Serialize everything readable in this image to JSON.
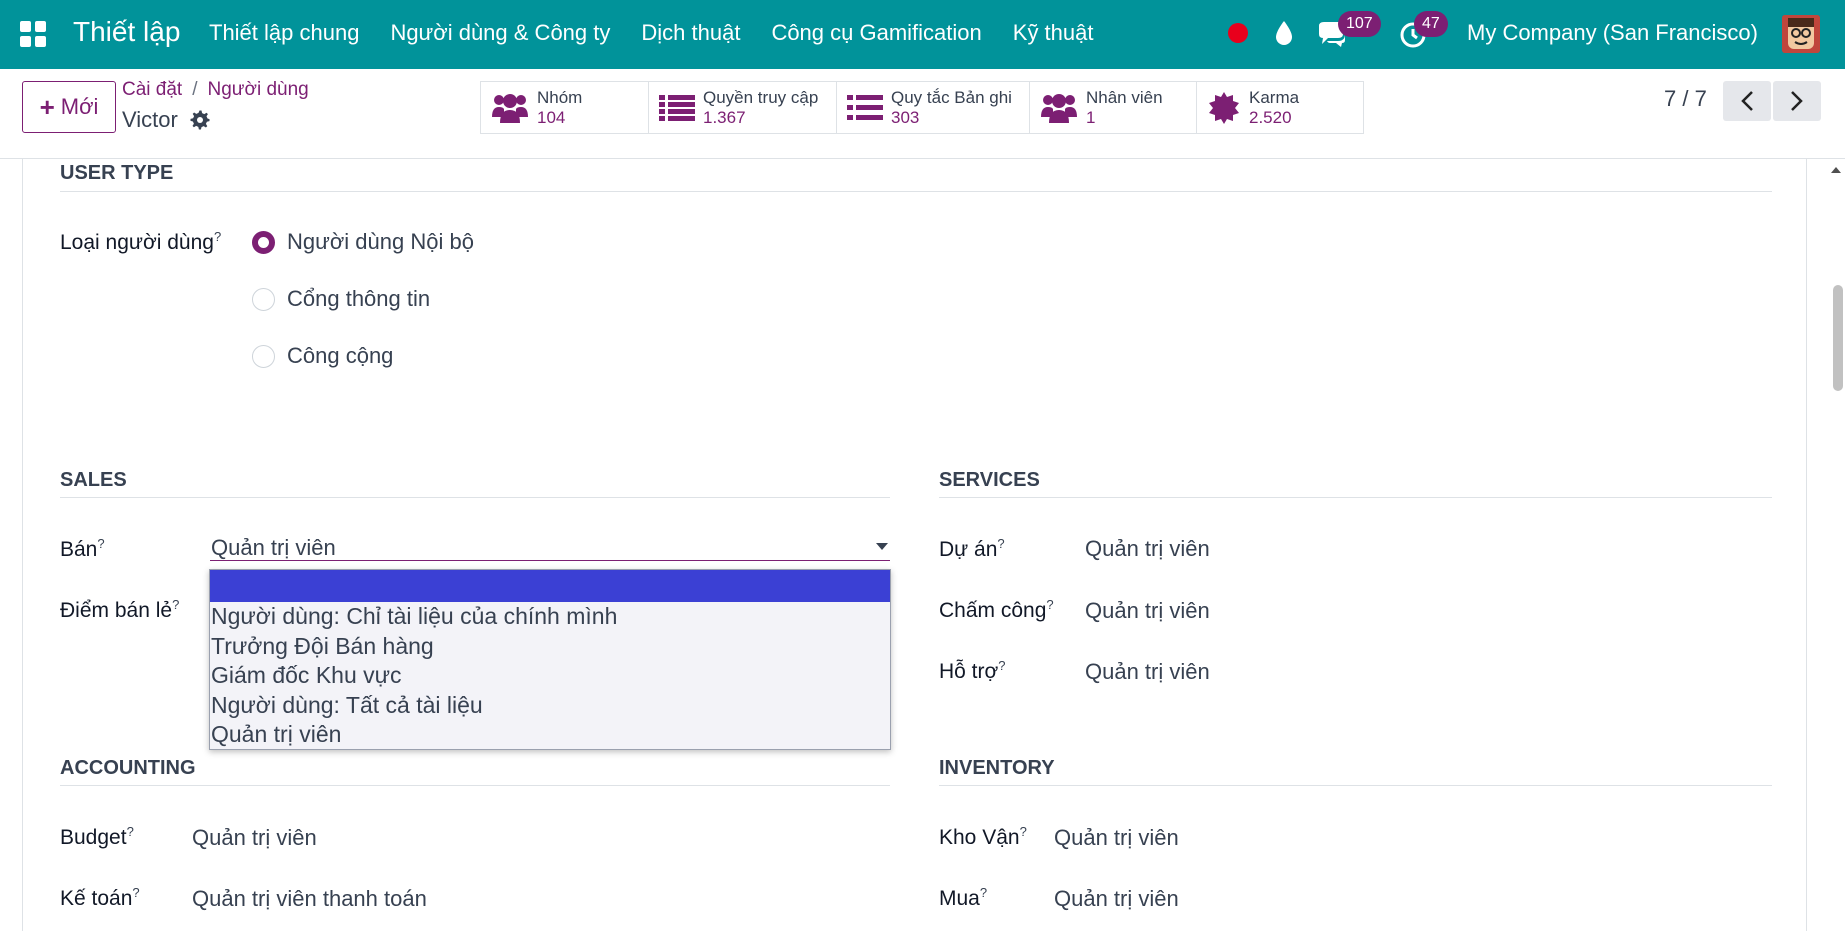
{
  "navbar": {
    "brand": "Thiết lập",
    "menu": [
      "Thiết lập chung",
      "Người dùng & Công ty",
      "Dịch thuật",
      "Công cụ Gamification",
      "Kỹ thuật"
    ],
    "chat_count": "107",
    "activity_count": "47",
    "company": "My Company (San Francisco)"
  },
  "control": {
    "new_label": "Mới",
    "breadcrumb": [
      "Cài đặt",
      "Người dùng"
    ],
    "breadcrumb_sep": "/",
    "record_name": "Victor",
    "smart_buttons": [
      {
        "label": "Nhóm",
        "value": "104",
        "icon": "users-icon"
      },
      {
        "label": "Quyền truy cập",
        "value": "1.367",
        "icon": "list-icon"
      },
      {
        "label": "Quy tắc Bản ghi",
        "value": "303",
        "icon": "list-icon"
      },
      {
        "label": "Nhân viên",
        "value": "1",
        "icon": "users-icon"
      },
      {
        "label": "Karma",
        "value": "2.520",
        "icon": "badge-icon"
      }
    ],
    "pager": "7 / 7"
  },
  "form": {
    "user_type": {
      "title": "USER TYPE",
      "label": "Loại người dùng",
      "help": "?",
      "options": [
        "Người dùng Nội bộ",
        "Cổng thông tin",
        "Công cộng"
      ],
      "selected_index": 0
    },
    "sales": {
      "title": "SALES",
      "sales_label": "Bán",
      "sales_value": "Quản trị viên",
      "pos_label": "Điểm bán lẻ"
    },
    "services": {
      "title": "SERVICES",
      "project_label": "Dự án",
      "project_value": "Quản trị viên",
      "timesheet_label": "Chấm công",
      "timesheet_value": "Quản trị viên",
      "helpdesk_label": "Hỗ trợ",
      "helpdesk_value": "Quản trị viên"
    },
    "accounting": {
      "title": "ACCOUNTING",
      "budget_label": "Budget",
      "budget_value": "Quản trị viên",
      "accounting_label": "Kế toán",
      "accounting_value": "Quản trị viên thanh toán"
    },
    "inventory": {
      "title": "INVENTORY",
      "stock_label": "Kho Vận",
      "stock_value": "Quản trị viên",
      "purchase_label": "Mua",
      "purchase_value": "Quản trị viên"
    },
    "help_mark": "?"
  },
  "dropdown": {
    "options": [
      "",
      "Người dùng: Chỉ tài liệu của chính mình",
      "Trưởng Đội Bán hàng",
      "Giám đốc Khu vực",
      "Người dùng: Tất cả tài liệu",
      "Quản trị viên"
    ],
    "highlighted_index": 0,
    "highlight_color": "#3b40d4"
  },
  "colors": {
    "navbar": "#01939a",
    "accent": "#7c1f73"
  }
}
